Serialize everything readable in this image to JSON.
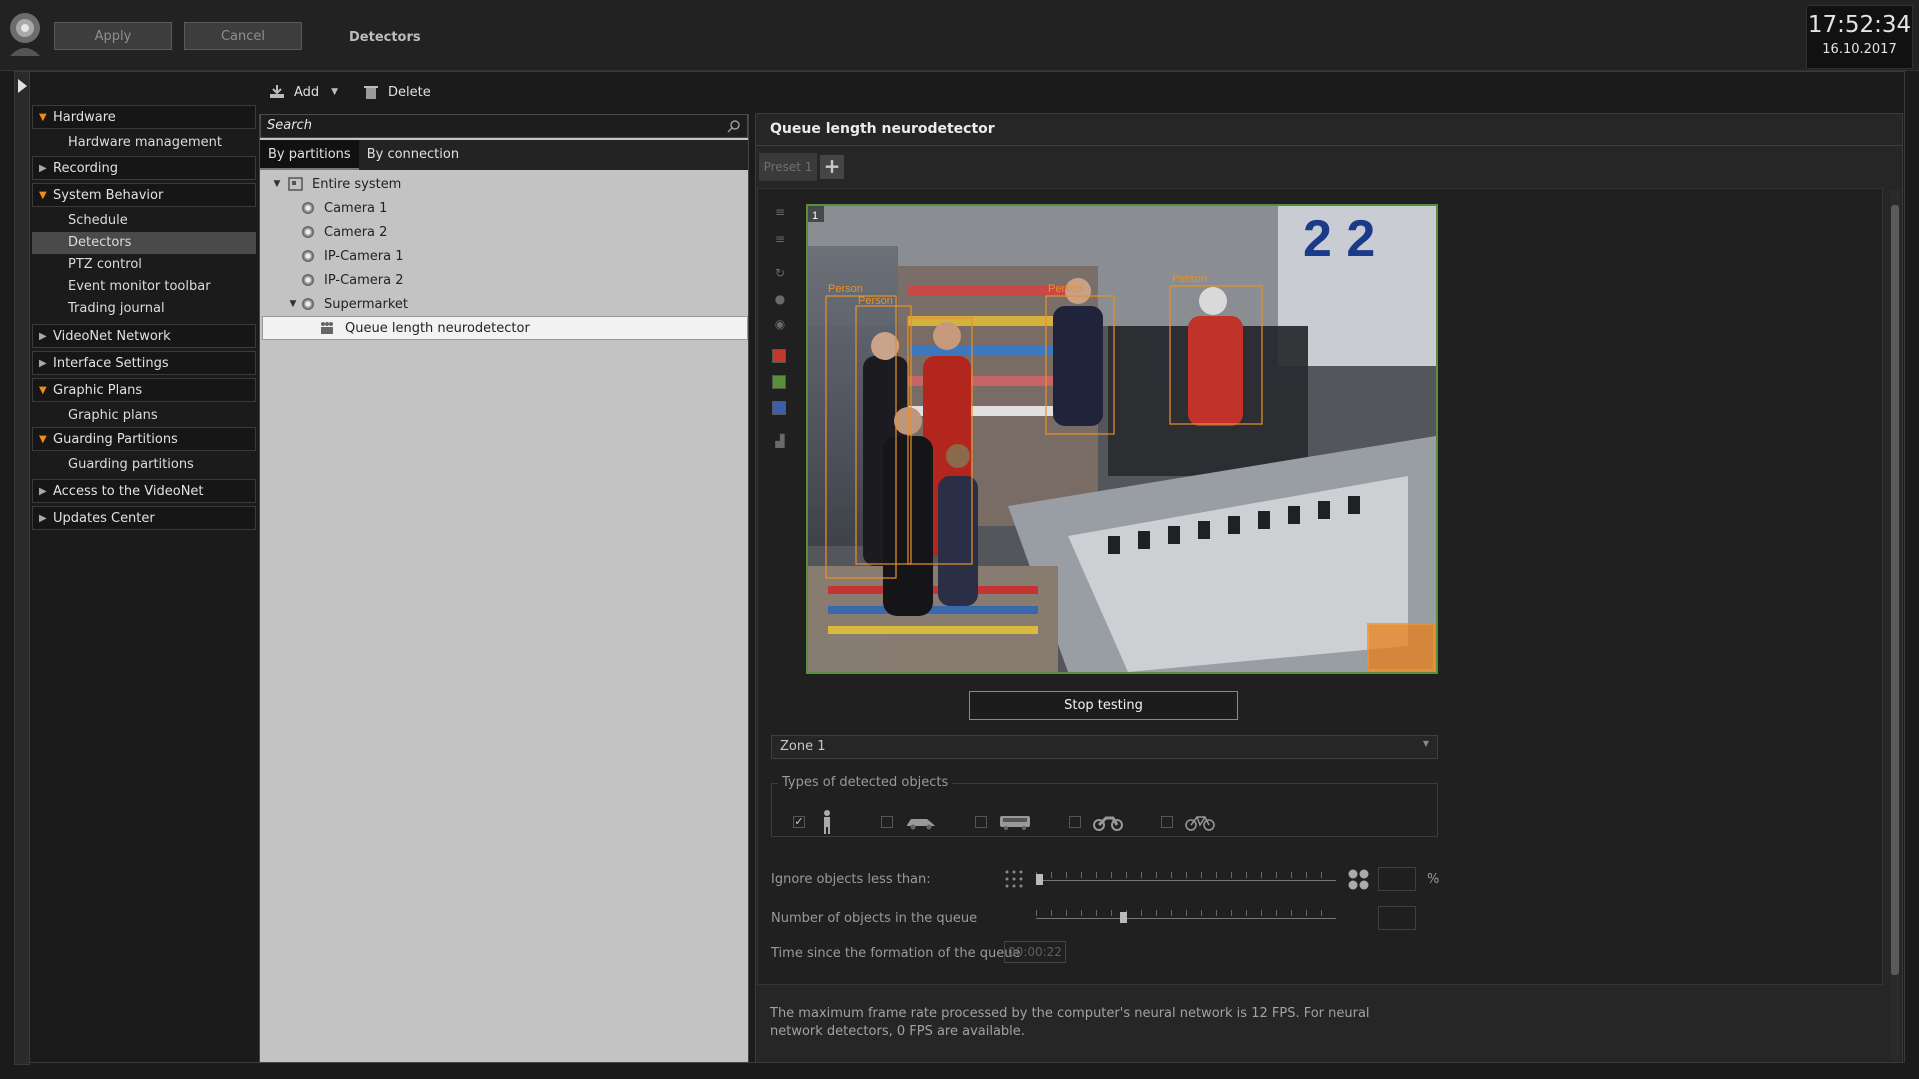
{
  "header": {
    "apply_label": "Apply",
    "cancel_label": "Cancel",
    "title": "Detectors",
    "time": "17:52:34",
    "date": "16.10.2017"
  },
  "sidebar": {
    "sections": [
      {
        "label": "Hardware",
        "expanded": true
      },
      {
        "label": "Recording",
        "expanded": false
      },
      {
        "label": "System Behavior",
        "expanded": true
      },
      {
        "label": "VideoNet Network",
        "expanded": false
      },
      {
        "label": "Interface Settings",
        "expanded": false
      },
      {
        "label": "Graphic Plans",
        "expanded": true
      },
      {
        "label": "Guarding Partitions",
        "expanded": true
      },
      {
        "label": "Access to the VideoNet",
        "expanded": false
      },
      {
        "label": "Updates Center",
        "expanded": false
      }
    ],
    "items": {
      "hardware_management": "Hardware management",
      "schedule": "Schedule",
      "detectors": "Detectors",
      "ptz_control": "PTZ control",
      "event_monitor_toolbar": "Event monitor toolbar",
      "trading_journal": "Trading journal",
      "graphic_plans": "Graphic plans",
      "guarding_partitions": "Guarding partitions"
    },
    "selected_item": "Detectors"
  },
  "toolbar": {
    "add_label": "Add",
    "delete_label": "Delete"
  },
  "tree": {
    "search_placeholder": "Search",
    "tab_partitions": "By partitions",
    "tab_connection": "By connection",
    "root": "Entire system",
    "camera1": "Camera 1",
    "camera2": "Camera 2",
    "ipcamera1": "IP-Camera 1",
    "ipcamera2": "IP-Camera 2",
    "supermarket": "Supermarket",
    "detector": "Queue length neurodetector"
  },
  "detector_panel": {
    "title": "Queue length neurodetector",
    "preset_label": "Preset 1",
    "video_index": "1",
    "person_label": "Person",
    "stop_testing_label": "Stop testing",
    "zone_value": "Zone 1",
    "types_legend": "Types of detected objects",
    "object_types": [
      {
        "icon": "person-icon",
        "checked": true
      },
      {
        "icon": "car-icon",
        "checked": false
      },
      {
        "icon": "bus-icon",
        "checked": false
      },
      {
        "icon": "motorcycle-icon",
        "checked": false
      },
      {
        "icon": "bicycle-icon",
        "checked": false
      }
    ],
    "ignore_label": "Ignore objects less than:",
    "ignore_unit": "%",
    "queue_count_label": "Number of objects in the queue",
    "time_label": "Time since the formation of the queue",
    "time_value": "00:00:22",
    "info_text": "The maximum frame rate processed by the computer's neural network is 12 FPS. For neural network detectors, 0 FPS are available."
  },
  "colors": {
    "accent_orange": "#f28b1c",
    "zone_green": "#5a8f3a",
    "background": "#1b1b1b"
  }
}
